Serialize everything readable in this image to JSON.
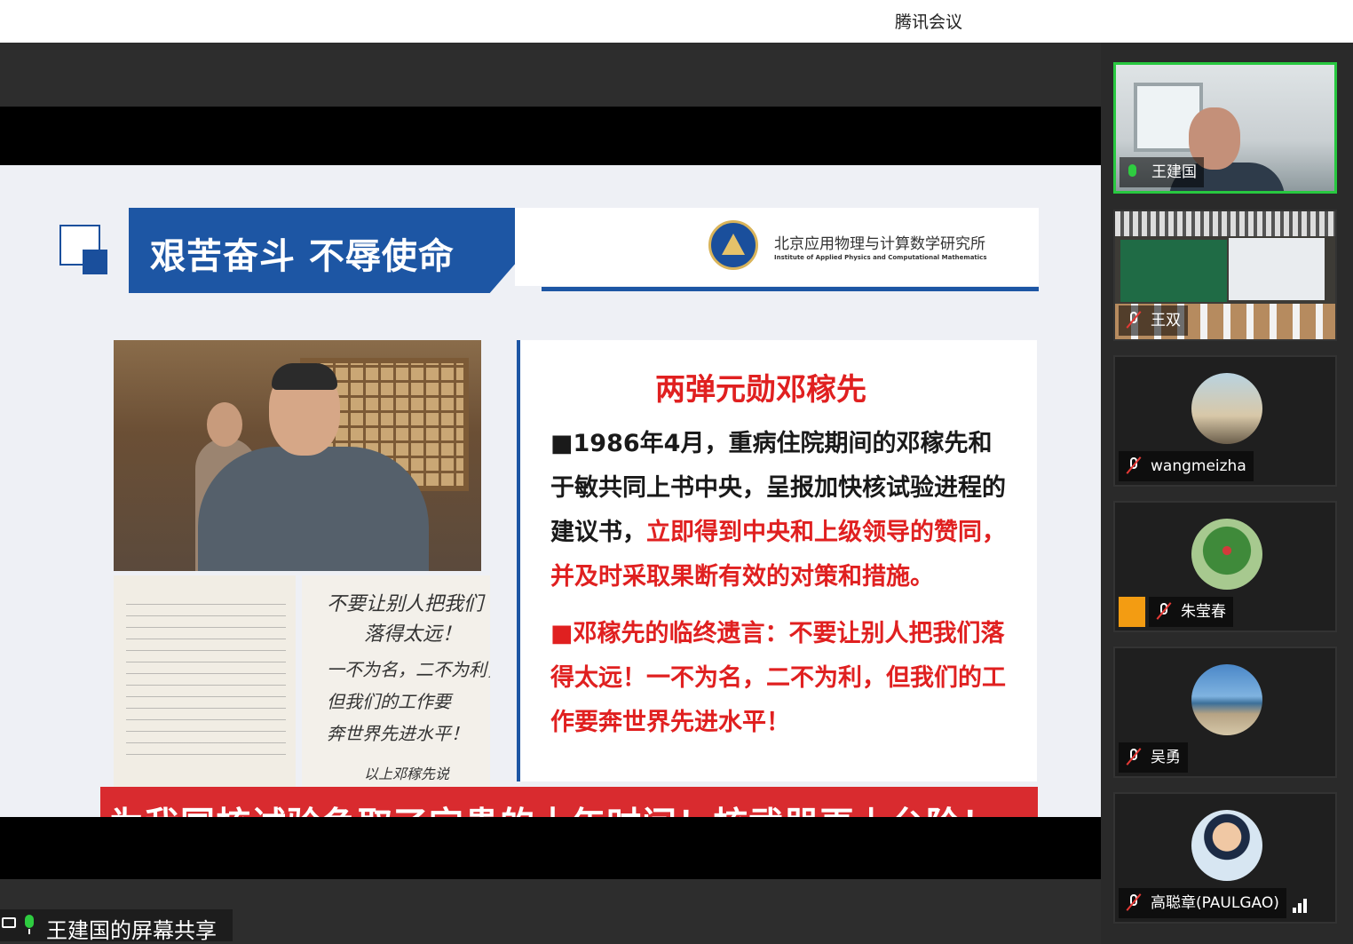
{
  "window": {
    "app_title": "腾讯会议"
  },
  "slide": {
    "title": "艰苦奋斗  不辱使命",
    "institute_cn": "北京应用物理与计算数学研究所",
    "institute_en": "Institute of Applied Physics and Computational Mathematics",
    "heading": "两弹元勋邓稼先",
    "para1_black": "■1986年4月，重病住院期间的邓稼先和于敏共同上书中央，呈报加快核试验进程的建议书，",
    "para1_red": "立即得到中央和上级领导的赞同，并及时采取果断有效的对策和措施。",
    "para2": "■邓稼先的临终遗言：不要让别人把我们落得太远！一不为名，二不为利，但我们的工作要奔世界先进水平！",
    "banner": "为我国核试验争取了宝贵的十年时间！核武器再上台阶！",
    "handwriting": [
      "不要让别人把我们",
      "落得太远！",
      "一不为名，二不为利，",
      "但我们的工作要",
      "奔世界先进水平！",
      "以上邓稼先说"
    ]
  },
  "sharer_label": "王建国的屏幕共享",
  "participants": [
    {
      "name": "王建国",
      "mic": "on"
    },
    {
      "name": "王双",
      "mic": "muted"
    },
    {
      "name": "wangmeizha",
      "mic": "muted"
    },
    {
      "name": "朱莹春",
      "mic": "muted"
    },
    {
      "name": "吴勇",
      "mic": "muted"
    },
    {
      "name": "高聪章(PAULGAO)",
      "mic": "muted"
    }
  ],
  "colors": {
    "accent_blue": "#1d56a4",
    "accent_red": "#e02020",
    "active_green": "#28c840"
  }
}
